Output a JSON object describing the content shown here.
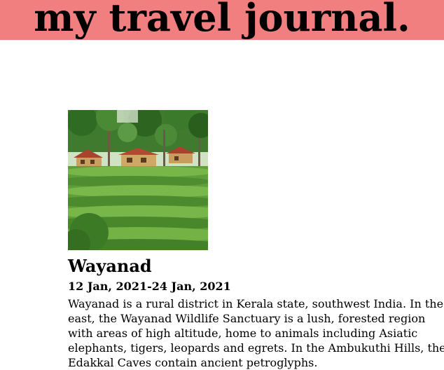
{
  "header": {
    "title": "my travel journal."
  },
  "entry": {
    "image_alt": "Wayanad tea plantation with cottages",
    "title": "Wayanad",
    "dates": "12 Jan, 2021-24 Jan, 2021",
    "description": "Wayanad is a rural district in Kerala state, southwest India. In the east, the Wayanad Wildlife Sanctuary is a lush, forested region with areas of high altitude, home to animals including Asiatic elephants, tigers, leopards and egrets. In the Ambukuthi Hills, the Edakkal Caves contain ancient petroglyphs."
  },
  "colors": {
    "header_bg": "#f27f7f"
  }
}
